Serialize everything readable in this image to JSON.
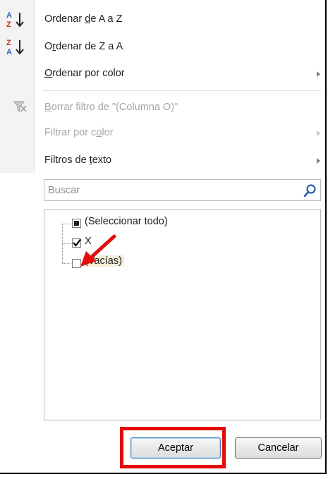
{
  "menu": {
    "sort_az": {
      "pre": "Ordenar ",
      "key": "d",
      "post": "e A a Z",
      "icon": "sort-ascending-icon"
    },
    "sort_za": {
      "pre": "O",
      "key": "r",
      "post": "denar de Z a A",
      "icon": "sort-descending-icon"
    },
    "sort_color": {
      "pre": "",
      "key": "O",
      "post": "rdenar por color",
      "submenu": true
    },
    "clear_filter": {
      "pre": "",
      "key": "B",
      "post": "orrar filtro de \"(Columna O)\"",
      "icon": "clear-filter-icon",
      "disabled": true
    },
    "filter_color": {
      "pre": "Filtrar por c",
      "key": "o",
      "post": "lor",
      "submenu": true,
      "disabled": true
    },
    "text_filters": {
      "pre": "Filtros de ",
      "key": "t",
      "post": "exto",
      "submenu": true
    }
  },
  "search": {
    "placeholder": "Buscar",
    "value": "",
    "icon": "search-icon"
  },
  "list": {
    "items": [
      {
        "label": "(Seleccionar todo)",
        "state": "indeterminate"
      },
      {
        "label": "X",
        "state": "checked"
      },
      {
        "label": "(Vacías)",
        "state": "unchecked"
      }
    ]
  },
  "buttons": {
    "ok": "Aceptar",
    "cancel": "Cancelar"
  },
  "colors": {
    "annotation_red": "#e50b0b",
    "disabled_text": "#a6a6a6",
    "highlight_bg": "#f4eed9"
  }
}
